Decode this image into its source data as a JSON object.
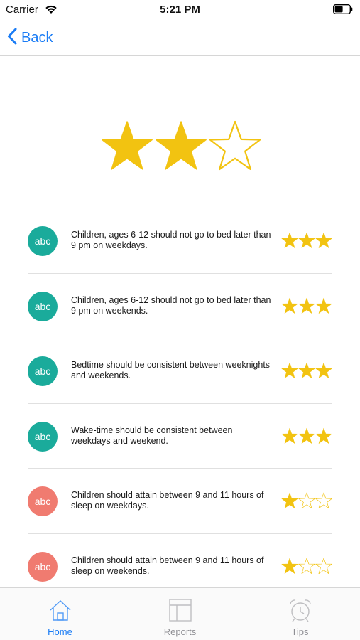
{
  "status_bar": {
    "carrier": "Carrier",
    "time": "5:21 PM"
  },
  "nav": {
    "back_label": "Back"
  },
  "overall_rating": {
    "score": 2,
    "max": 3,
    "filled_color": "#f2c311",
    "empty_color": "#f2c311"
  },
  "rules": [
    {
      "badge": "abc",
      "badge_color": "#1aab9b",
      "text": "Children, ages 6-12 should not go to bed later than 9 pm on weekdays.",
      "stars": 3
    },
    {
      "badge": "abc",
      "badge_color": "#1aab9b",
      "text": "Children, ages 6-12 should not go to bed later than 9 pm on weekends.",
      "stars": 3
    },
    {
      "badge": "abc",
      "badge_color": "#1aab9b",
      "text": "Bedtime should be consistent between weeknights and weekends.",
      "stars": 3
    },
    {
      "badge": "abc",
      "badge_color": "#1aab9b",
      "text": "Wake-time should be consistent between weekdays and weekend.",
      "stars": 3
    },
    {
      "badge": "abc",
      "badge_color": "#f07b70",
      "text": "Children should attain between 9 and 11 hours of sleep on weekdays.",
      "stars": 1
    },
    {
      "badge": "abc",
      "badge_color": "#f07b70",
      "text": "Children should attain between 9 and 11 hours of sleep on weekends.",
      "stars": 1
    }
  ],
  "rule_star_max": 3,
  "tabs": [
    {
      "label": "Home",
      "icon": "home-icon",
      "active": true
    },
    {
      "label": "Reports",
      "icon": "reports-icon",
      "active": false
    },
    {
      "label": "Tips",
      "icon": "alarm-clock-icon",
      "active": false
    }
  ],
  "colors": {
    "accent": "#1a7cf5",
    "star": "#f2c311",
    "tab_active": "#1a7cf5",
    "tab_inactive": "#8e8e93"
  }
}
